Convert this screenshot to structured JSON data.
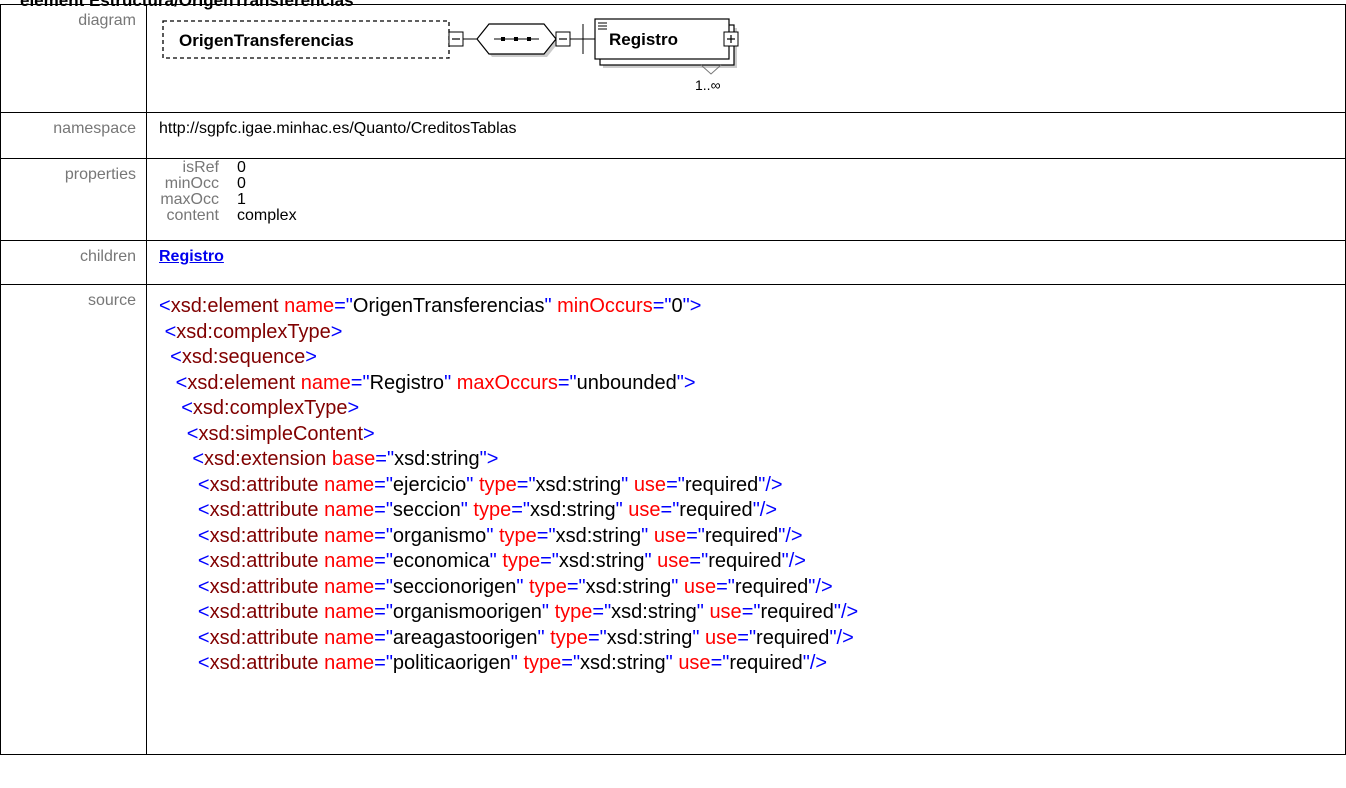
{
  "heading": "element Estructura/OrigenTransferencias",
  "labels": {
    "diagram": "diagram",
    "namespace": "namespace",
    "properties": "properties",
    "children": "children",
    "source": "source"
  },
  "diagram": {
    "element_name": "OrigenTransferencias",
    "child_name": "Registro",
    "cardinality": "1..∞"
  },
  "namespace": "http://sgpfc.igae.minhac.es/Quanto/CreditosTablas",
  "properties": [
    {
      "key": "isRef",
      "value": "0"
    },
    {
      "key": "minOcc",
      "value": "0"
    },
    {
      "key": "maxOcc",
      "value": "1"
    },
    {
      "key": "content",
      "value": "complex"
    }
  ],
  "children": [
    "Registro"
  ],
  "source": {
    "line1": {
      "tag": "element",
      "name": "OrigenTransferencias",
      "minOccurs": "0"
    },
    "complexType": "complexType",
    "sequence": "sequence",
    "inner_element": {
      "tag": "element",
      "name": "Registro",
      "maxOccurs": "unbounded"
    },
    "simpleContent": "simpleContent",
    "extension": {
      "tag": "extension",
      "base": "xsd:string"
    },
    "attributes": [
      {
        "name": "ejercicio",
        "type": "xsd:string",
        "use": "required"
      },
      {
        "name": "seccion",
        "type": "xsd:string",
        "use": "required"
      },
      {
        "name": "organismo",
        "type": "xsd:string",
        "use": "required"
      },
      {
        "name": "economica",
        "type": "xsd:string",
        "use": "required"
      },
      {
        "name": "seccionorigen",
        "type": "xsd:string",
        "use": "required"
      },
      {
        "name": "organismoorigen",
        "type": "xsd:string",
        "use": "required"
      },
      {
        "name": "areagastoorigen",
        "type": "xsd:string",
        "use": "required"
      },
      {
        "name": "politicaorigen",
        "type": "xsd:string",
        "use": "required"
      }
    ]
  }
}
